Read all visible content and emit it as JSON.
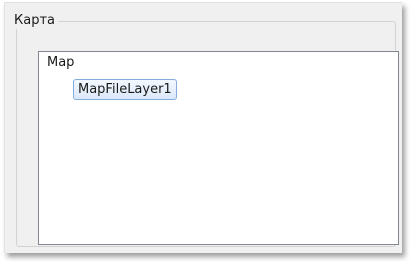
{
  "group": {
    "title": "Карта"
  },
  "tree": {
    "root_label": "Map",
    "children": [
      {
        "label": "MapFileLayer1",
        "selected": true
      }
    ]
  },
  "colors": {
    "selection_border": "#84acdd",
    "selection_fill": "#dbe8f9",
    "panel_background": "#f0f0f0"
  }
}
